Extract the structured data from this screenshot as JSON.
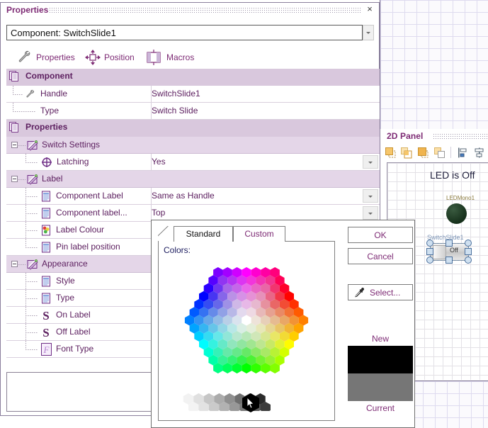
{
  "properties_panel": {
    "title": "Properties",
    "close_label": "×",
    "combo": {
      "value": "Component: SwitchSlide1",
      "placeholder": "Component: SwitchSlide1"
    },
    "icon_tabs": [
      {
        "label": "Properties",
        "icon": "wrench-icon"
      },
      {
        "label": "Position",
        "icon": "move-arrows-icon"
      },
      {
        "label": "Macros",
        "icon": "macros-icon"
      }
    ],
    "tree": [
      {
        "level": 0,
        "kind": "category",
        "icon": "pages-icon",
        "name": "Component",
        "value": ""
      },
      {
        "level": 1,
        "kind": "leaf",
        "icon": "wrench-icon",
        "name": "Handle",
        "value": "SwitchSlide1"
      },
      {
        "level": 1,
        "kind": "leaf",
        "icon": "none",
        "name": "Type",
        "value": "Switch Slide"
      },
      {
        "level": 0,
        "kind": "category",
        "icon": "pages-icon",
        "name": "Properties",
        "value": ""
      },
      {
        "level": 1,
        "kind": "group",
        "icon": "folder-pencil-icon",
        "name": "Switch Settings",
        "value": "",
        "expanded": true
      },
      {
        "level": 2,
        "kind": "leaf",
        "icon": "target-icon",
        "name": "Latching",
        "value": "Yes",
        "dropdown": true
      },
      {
        "level": 1,
        "kind": "group",
        "icon": "folder-pencil-icon",
        "name": "Label",
        "value": "",
        "expanded": true
      },
      {
        "level": 2,
        "kind": "leaf",
        "icon": "doc-icon",
        "name": "Component Label",
        "value": "Same as Handle",
        "dropdown": true
      },
      {
        "level": 2,
        "kind": "leaf",
        "icon": "doc-icon",
        "name": "Component label...",
        "value": "Top",
        "dropdown": true
      },
      {
        "level": 2,
        "kind": "leaf",
        "icon": "palette-icon",
        "name": "Label Colour",
        "value": ""
      },
      {
        "level": 2,
        "kind": "leaf",
        "icon": "doc-icon",
        "name": "Pin label position",
        "value": ""
      },
      {
        "level": 1,
        "kind": "group",
        "icon": "folder-pencil-icon",
        "name": "Appearance",
        "value": "",
        "expanded": true
      },
      {
        "level": 2,
        "kind": "leaf",
        "icon": "doc-icon",
        "name": "Style",
        "value": ""
      },
      {
        "level": 2,
        "kind": "leaf",
        "icon": "doc-icon",
        "name": "Type",
        "value": ""
      },
      {
        "level": 2,
        "kind": "leaf",
        "icon": "string-s-icon",
        "name": "On Label",
        "value": ""
      },
      {
        "level": 2,
        "kind": "leaf",
        "icon": "string-s-icon",
        "name": "Off Label",
        "value": ""
      },
      {
        "level": 2,
        "kind": "leaf",
        "icon": "font-type-icon",
        "name": "Font Type",
        "value": ""
      }
    ],
    "description_box": ""
  },
  "color_dialog": {
    "tabs": [
      {
        "label": "Standard",
        "active": true
      },
      {
        "label": "Custom",
        "active": false
      }
    ],
    "colors_label": "Colors:",
    "buttons": {
      "ok": "OK",
      "cancel": "Cancel",
      "select": "Select...",
      "select_icon": "eyedropper-icon"
    },
    "preview": {
      "new_label": "New",
      "current_label": "Current",
      "new_color": "#000000",
      "current_color": "#767676"
    }
  },
  "panel_2d": {
    "title": "2D Panel",
    "toolbar_icons": [
      "bring-to-front-icon",
      "send-to-back-icon",
      "bring-forward-icon",
      "send-backward-icon",
      "align-left-icon",
      "align-center-icon"
    ],
    "canvas": {
      "heading": "LED is Off",
      "led": {
        "label": "LEDMono1",
        "color": "#1b3520"
      },
      "switch": {
        "label": "SwitchSlide1",
        "state_text": "Off",
        "selected": true
      }
    }
  },
  "colors": {
    "accent_purple": "#7d2a74",
    "tree_category_bg": "#d9c8dd",
    "tree_group_bg": "#e4d6e8",
    "text_purple": "#5d2060"
  },
  "chart_data": null
}
